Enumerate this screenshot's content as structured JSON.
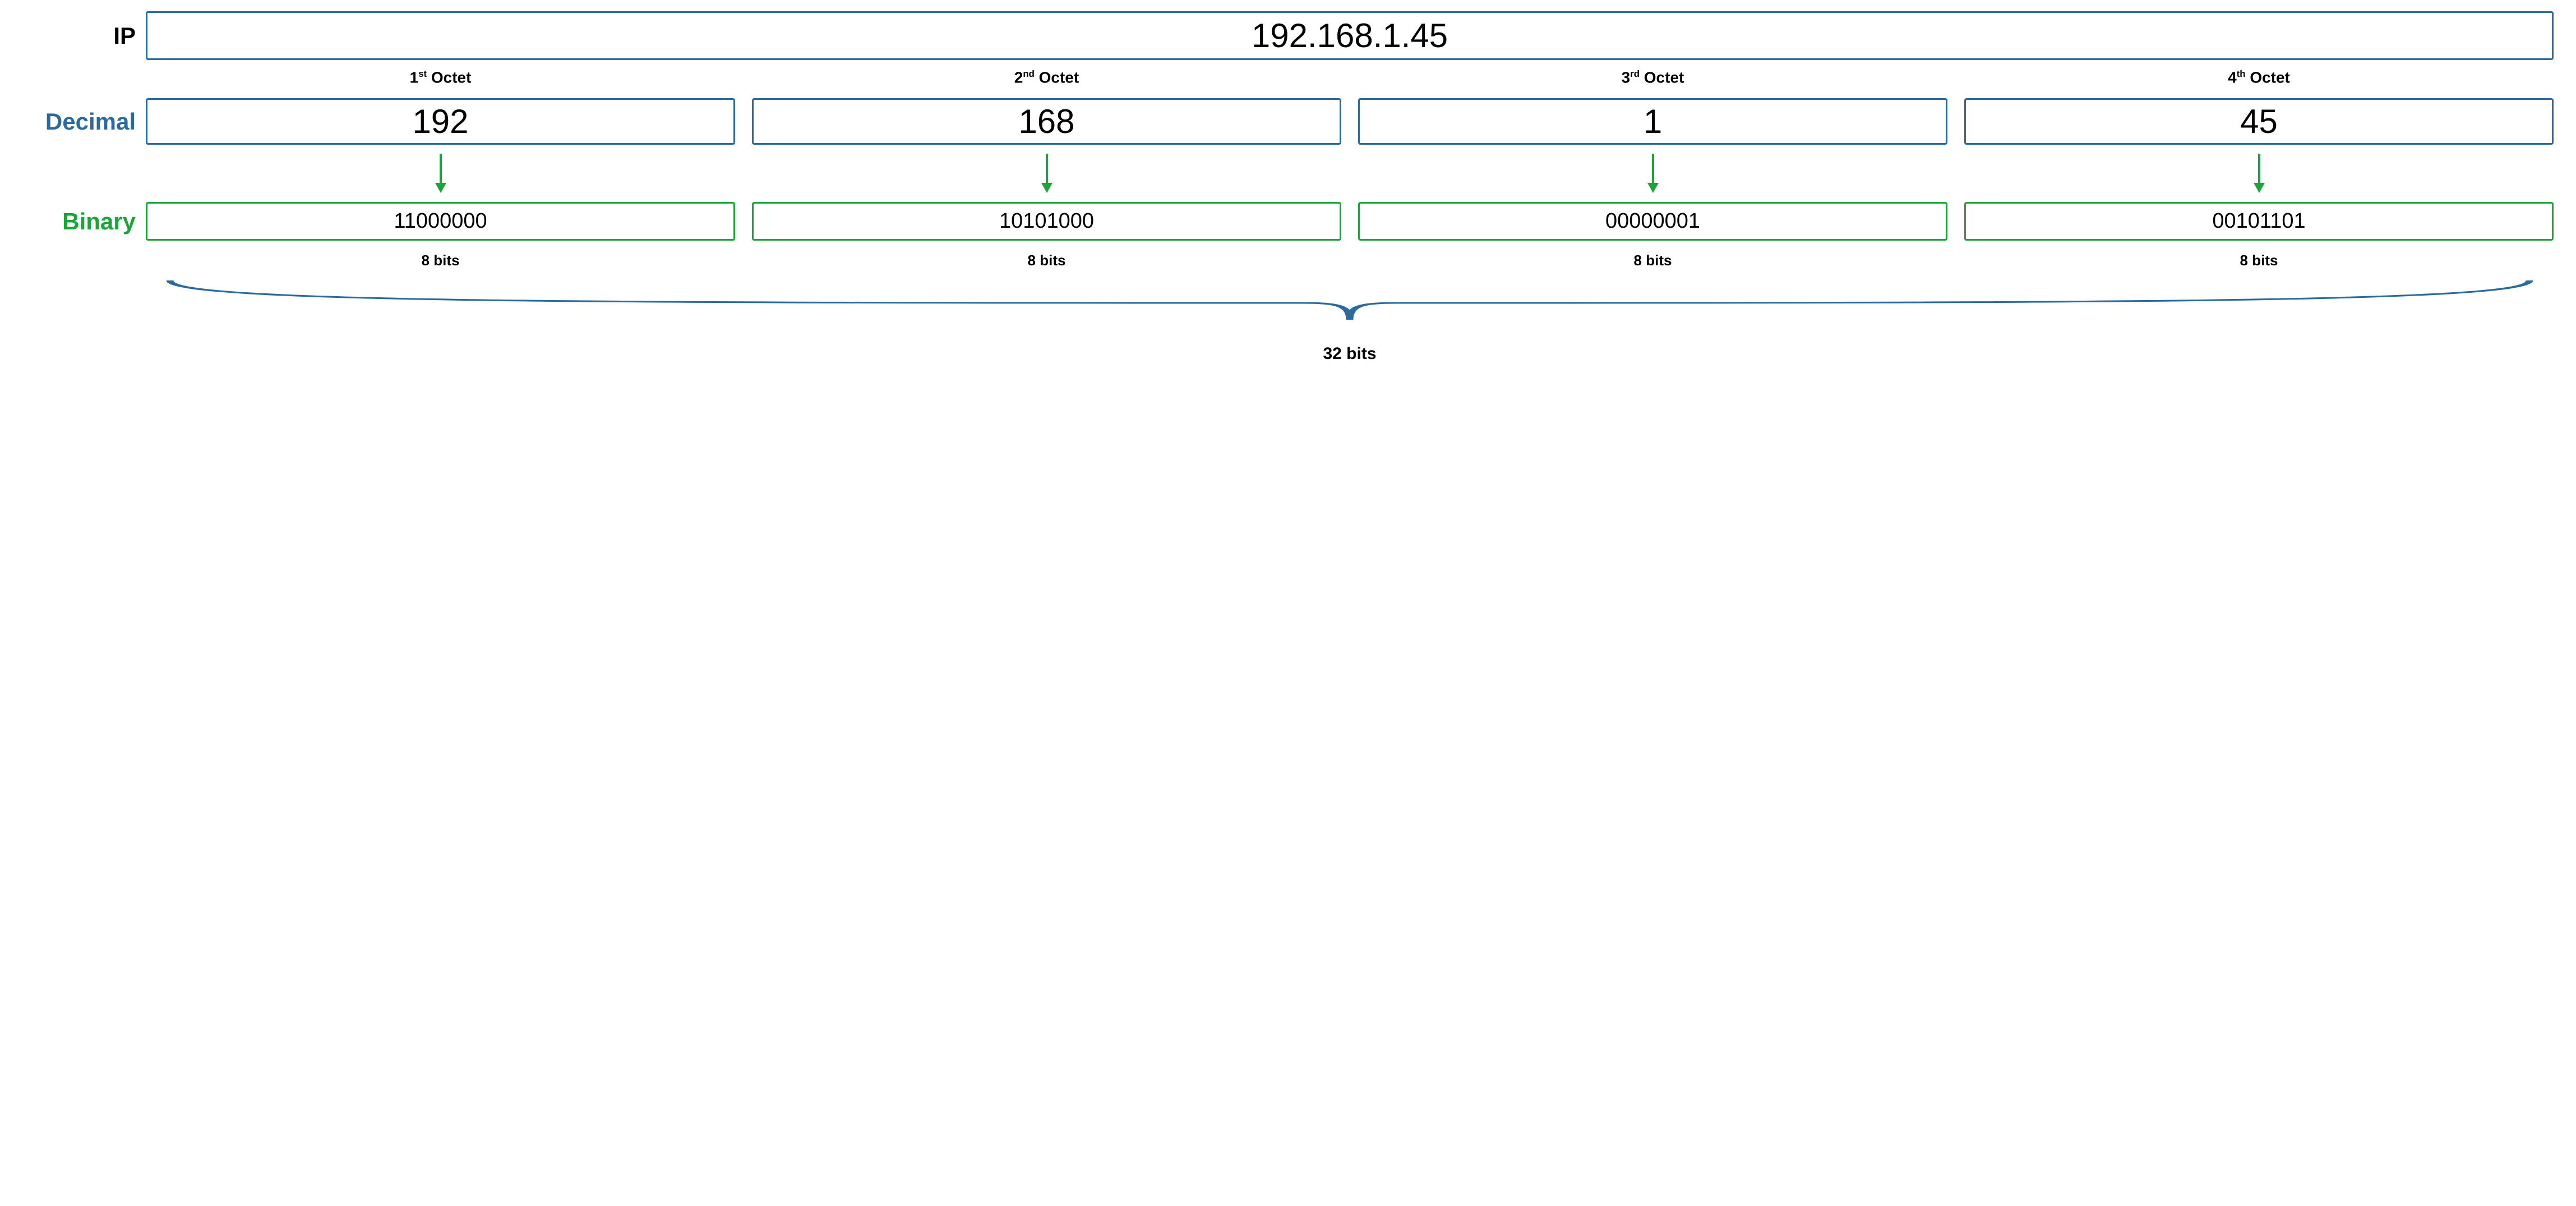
{
  "labels": {
    "ip": "IP",
    "decimal": "Decimal",
    "binary": "Binary"
  },
  "ip_address": "192.168.1.45",
  "octets": [
    {
      "ordinal": "1",
      "suffix": "st",
      "title_word": "Octet",
      "decimal": "192",
      "binary": "11000000",
      "bits_label": "8 bits"
    },
    {
      "ordinal": "2",
      "suffix": "nd",
      "title_word": "Octet",
      "decimal": "168",
      "binary": "10101000",
      "bits_label": "8 bits"
    },
    {
      "ordinal": "3",
      "suffix": "rd",
      "title_word": "Octet",
      "decimal": "1",
      "binary": "00000001",
      "bits_label": "8 bits"
    },
    {
      "ordinal": "4",
      "suffix": "th",
      "title_word": "Octet",
      "decimal": "45",
      "binary": "00101101",
      "bits_label": "8 bits"
    }
  ],
  "total_bits": "32 bits",
  "colors": {
    "blue": "#2a6a9e",
    "green": "#1aa53a"
  }
}
